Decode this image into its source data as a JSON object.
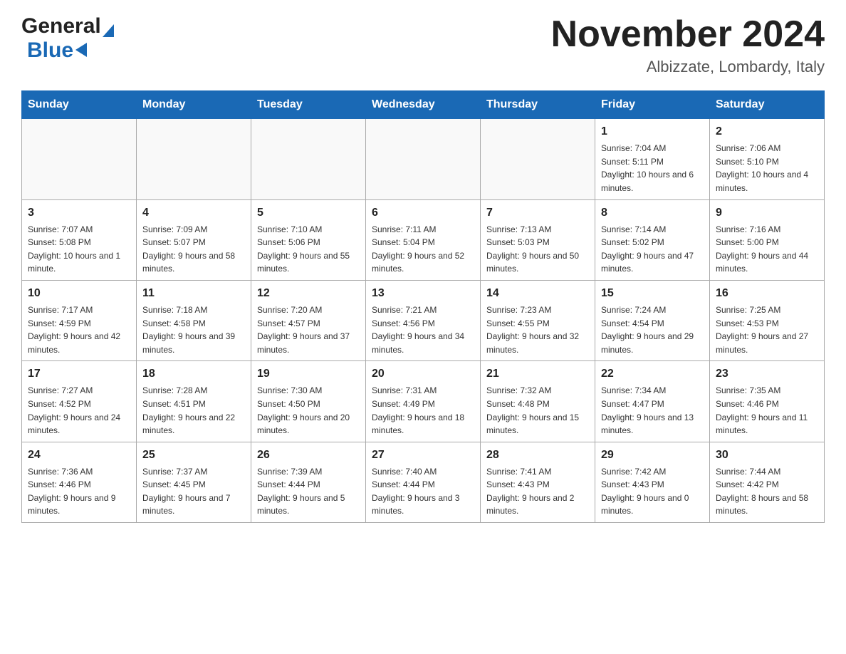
{
  "header": {
    "logo_general": "General",
    "logo_blue": "Blue",
    "month_year": "November 2024",
    "location": "Albizzate, Lombardy, Italy"
  },
  "days_of_week": [
    "Sunday",
    "Monday",
    "Tuesday",
    "Wednesday",
    "Thursday",
    "Friday",
    "Saturday"
  ],
  "weeks": [
    [
      {
        "day": "",
        "info": ""
      },
      {
        "day": "",
        "info": ""
      },
      {
        "day": "",
        "info": ""
      },
      {
        "day": "",
        "info": ""
      },
      {
        "day": "",
        "info": ""
      },
      {
        "day": "1",
        "info": "Sunrise: 7:04 AM\nSunset: 5:11 PM\nDaylight: 10 hours and 6 minutes."
      },
      {
        "day": "2",
        "info": "Sunrise: 7:06 AM\nSunset: 5:10 PM\nDaylight: 10 hours and 4 minutes."
      }
    ],
    [
      {
        "day": "3",
        "info": "Sunrise: 7:07 AM\nSunset: 5:08 PM\nDaylight: 10 hours and 1 minute."
      },
      {
        "day": "4",
        "info": "Sunrise: 7:09 AM\nSunset: 5:07 PM\nDaylight: 9 hours and 58 minutes."
      },
      {
        "day": "5",
        "info": "Sunrise: 7:10 AM\nSunset: 5:06 PM\nDaylight: 9 hours and 55 minutes."
      },
      {
        "day": "6",
        "info": "Sunrise: 7:11 AM\nSunset: 5:04 PM\nDaylight: 9 hours and 52 minutes."
      },
      {
        "day": "7",
        "info": "Sunrise: 7:13 AM\nSunset: 5:03 PM\nDaylight: 9 hours and 50 minutes."
      },
      {
        "day": "8",
        "info": "Sunrise: 7:14 AM\nSunset: 5:02 PM\nDaylight: 9 hours and 47 minutes."
      },
      {
        "day": "9",
        "info": "Sunrise: 7:16 AM\nSunset: 5:00 PM\nDaylight: 9 hours and 44 minutes."
      }
    ],
    [
      {
        "day": "10",
        "info": "Sunrise: 7:17 AM\nSunset: 4:59 PM\nDaylight: 9 hours and 42 minutes."
      },
      {
        "day": "11",
        "info": "Sunrise: 7:18 AM\nSunset: 4:58 PM\nDaylight: 9 hours and 39 minutes."
      },
      {
        "day": "12",
        "info": "Sunrise: 7:20 AM\nSunset: 4:57 PM\nDaylight: 9 hours and 37 minutes."
      },
      {
        "day": "13",
        "info": "Sunrise: 7:21 AM\nSunset: 4:56 PM\nDaylight: 9 hours and 34 minutes."
      },
      {
        "day": "14",
        "info": "Sunrise: 7:23 AM\nSunset: 4:55 PM\nDaylight: 9 hours and 32 minutes."
      },
      {
        "day": "15",
        "info": "Sunrise: 7:24 AM\nSunset: 4:54 PM\nDaylight: 9 hours and 29 minutes."
      },
      {
        "day": "16",
        "info": "Sunrise: 7:25 AM\nSunset: 4:53 PM\nDaylight: 9 hours and 27 minutes."
      }
    ],
    [
      {
        "day": "17",
        "info": "Sunrise: 7:27 AM\nSunset: 4:52 PM\nDaylight: 9 hours and 24 minutes."
      },
      {
        "day": "18",
        "info": "Sunrise: 7:28 AM\nSunset: 4:51 PM\nDaylight: 9 hours and 22 minutes."
      },
      {
        "day": "19",
        "info": "Sunrise: 7:30 AM\nSunset: 4:50 PM\nDaylight: 9 hours and 20 minutes."
      },
      {
        "day": "20",
        "info": "Sunrise: 7:31 AM\nSunset: 4:49 PM\nDaylight: 9 hours and 18 minutes."
      },
      {
        "day": "21",
        "info": "Sunrise: 7:32 AM\nSunset: 4:48 PM\nDaylight: 9 hours and 15 minutes."
      },
      {
        "day": "22",
        "info": "Sunrise: 7:34 AM\nSunset: 4:47 PM\nDaylight: 9 hours and 13 minutes."
      },
      {
        "day": "23",
        "info": "Sunrise: 7:35 AM\nSunset: 4:46 PM\nDaylight: 9 hours and 11 minutes."
      }
    ],
    [
      {
        "day": "24",
        "info": "Sunrise: 7:36 AM\nSunset: 4:46 PM\nDaylight: 9 hours and 9 minutes."
      },
      {
        "day": "25",
        "info": "Sunrise: 7:37 AM\nSunset: 4:45 PM\nDaylight: 9 hours and 7 minutes."
      },
      {
        "day": "26",
        "info": "Sunrise: 7:39 AM\nSunset: 4:44 PM\nDaylight: 9 hours and 5 minutes."
      },
      {
        "day": "27",
        "info": "Sunrise: 7:40 AM\nSunset: 4:44 PM\nDaylight: 9 hours and 3 minutes."
      },
      {
        "day": "28",
        "info": "Sunrise: 7:41 AM\nSunset: 4:43 PM\nDaylight: 9 hours and 2 minutes."
      },
      {
        "day": "29",
        "info": "Sunrise: 7:42 AM\nSunset: 4:43 PM\nDaylight: 9 hours and 0 minutes."
      },
      {
        "day": "30",
        "info": "Sunrise: 7:44 AM\nSunset: 4:42 PM\nDaylight: 8 hours and 58 minutes."
      }
    ]
  ]
}
